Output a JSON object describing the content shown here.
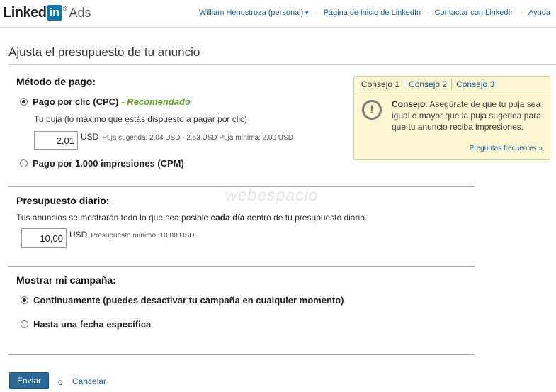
{
  "header": {
    "logo": {
      "linked": "Linked",
      "in": "in",
      "reg": "®",
      "product": "Ads"
    },
    "user_name": "William Henostroza (personal)",
    "nav_links": [
      "Página de inicio de LinkedIn",
      "Contactar con LinkedIn",
      "Ayuda"
    ],
    "separator": "·"
  },
  "page_title": "Ajusta el presupuesto de tu anuncio",
  "payment": {
    "title": "Método de pago:",
    "cpc_label": "Pago por clic (CPC)",
    "cpc_recommended": "- Recomendado",
    "cpc_selected": true,
    "bid_description": "Tu puja (lo máximo que estás dispuesto a pagar por clic)",
    "bid_value": "2,01",
    "bid_currency": "USD",
    "bid_hint": "Puja sugerida: 2,04 USD - 2,53 USD Puja mínima: 2,00 USD",
    "cpm_label": "Pago por 1.000 impresiones (CPM)",
    "cpm_selected": false
  },
  "daily_budget": {
    "title": "Presupuesto diario:",
    "desc_before": "Tus anuncios se mostrarán todo lo que sea posible ",
    "desc_bold": "cada día",
    "desc_after": " dentro de tu presupuesto diario.",
    "value": "10,00",
    "currency": "USD",
    "hint": "Presupuesto mínimo: 10,00 USD"
  },
  "campaign": {
    "title": "Mostrar mi campaña:",
    "continuous_label": "Continuamente (puedes desactivar tu campaña en cualquier momento)",
    "continuous_selected": true,
    "until_date_label": "Hasta una fecha específica",
    "until_date_selected": false
  },
  "tips": {
    "tabs": [
      "Consejo 1",
      "Consejo 2",
      "Consejo 3"
    ],
    "active_tab": 0,
    "icon": "exclamation-circle-icon",
    "heading": "Consejo",
    "body": ": Asegúrate de que tu puja sea igual o mayor que la puja sugerida para que tu anuncio reciba impresiones.",
    "faq_link": "Preguntas frecuentes »"
  },
  "watermark": "webespacio",
  "actions": {
    "submit": "Enviar",
    "or": "o",
    "cancel": "Cancelar"
  },
  "colors": {
    "accent_link": "#1f5d91",
    "recommended": "#6a9a2a",
    "button": "#2a6898",
    "tip_bg": "#fbf6d2"
  }
}
